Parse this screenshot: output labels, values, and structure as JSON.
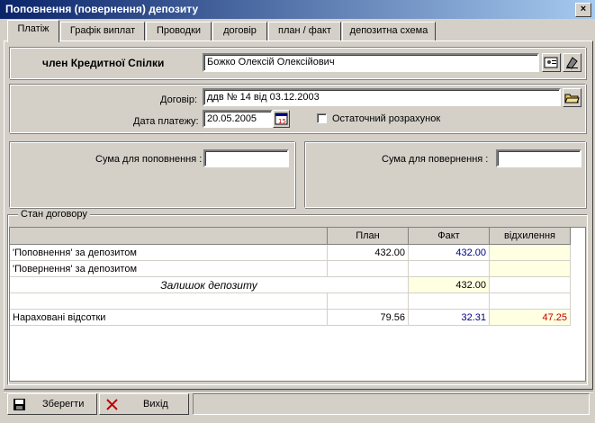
{
  "window": {
    "title": "Поповнення (повернення) депозиту",
    "close_label": "×"
  },
  "tabs": [
    {
      "label": "Платіж",
      "active": true
    },
    {
      "label": "Графік виплат"
    },
    {
      "label": "Проводки"
    },
    {
      "label": "договір"
    },
    {
      "label": "план / факт"
    },
    {
      "label": "депозитна схема"
    }
  ],
  "member": {
    "label": "член Кредитної Спілки",
    "value": "Божко Олексій Олексійович"
  },
  "contract": {
    "label": "Договір:",
    "value": "ддв № 14 від 03.12.2003",
    "date_label": "Дата платежу:",
    "date_value": "20.05.2005",
    "final_calc_label": "Остаточний розрахунок"
  },
  "amounts": {
    "top_up_label": "Сума для поповнення :",
    "top_up_value": "",
    "return_label": "Сума  для  повернення :",
    "return_value": ""
  },
  "state": {
    "legend": "Стан договору",
    "columns": [
      "",
      "План",
      "Факт",
      "відхилення"
    ],
    "rows": [
      {
        "name": "'Поповнення' за депозитом",
        "plan": "432.00",
        "fact": "432.00",
        "dev": ""
      },
      {
        "name": "'Повернення' за депозитом",
        "plan": "",
        "fact": "",
        "dev": ""
      },
      {
        "name": "Залишок депозиту",
        "plan": "",
        "fact": "432.00",
        "dev": ""
      },
      {
        "name": "",
        "plan": "",
        "fact": "",
        "dev": ""
      },
      {
        "name": "Нараховані відсотки",
        "plan": "79.56",
        "fact": "32.31",
        "dev": "47.25"
      }
    ]
  },
  "footer": {
    "save_label": "Зберегти",
    "exit_label": "Вихід"
  }
}
